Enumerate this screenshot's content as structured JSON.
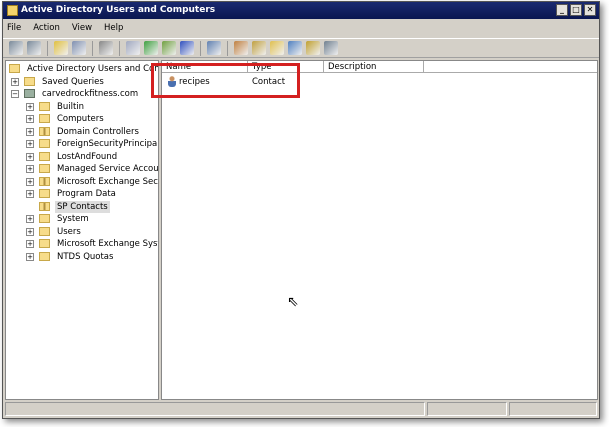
{
  "window": {
    "title": "Active Directory Users and Computers",
    "buttons": [
      "_",
      "□",
      "✕"
    ]
  },
  "menu": [
    "File",
    "Action",
    "View",
    "Help"
  ],
  "toolbar": [
    "back-icon",
    "forward-icon",
    "up-icon",
    "show-hide-tree-icon",
    "copy-icon",
    "properties-icon",
    "refresh-icon",
    "export-icon",
    "help-icon",
    "console-icon",
    "new-user-icon",
    "new-group-icon",
    "new-ou-icon",
    "filter-icon",
    "find-icon",
    "add-to-group-icon"
  ],
  "tree": [
    {
      "label": "Active Directory Users and Comput",
      "level": 0,
      "expander": "",
      "icon": "root"
    },
    {
      "label": "Saved Queries",
      "level": 1,
      "expander": "+",
      "icon": "folder"
    },
    {
      "label": "carvedrockfitness.com",
      "level": 1,
      "expander": "−",
      "icon": "domain"
    },
    {
      "label": "Builtin",
      "level": 2,
      "expander": "+",
      "icon": "folder"
    },
    {
      "label": "Computers",
      "level": 2,
      "expander": "+",
      "icon": "folder"
    },
    {
      "label": "Domain Controllers",
      "level": 2,
      "expander": "+",
      "icon": "ou"
    },
    {
      "label": "ForeignSecurityPrincipals",
      "level": 2,
      "expander": "+",
      "icon": "folder"
    },
    {
      "label": "LostAndFound",
      "level": 2,
      "expander": "+",
      "icon": "folder"
    },
    {
      "label": "Managed Service Accounts",
      "level": 2,
      "expander": "+",
      "icon": "folder"
    },
    {
      "label": "Microsoft Exchange Securit",
      "level": 2,
      "expander": "+",
      "icon": "ou"
    },
    {
      "label": "Program Data",
      "level": 2,
      "expander": "+",
      "icon": "folder"
    },
    {
      "label": "SP Contacts",
      "level": 2,
      "expander": "",
      "icon": "ou",
      "selected": true
    },
    {
      "label": "System",
      "level": 2,
      "expander": "+",
      "icon": "folder"
    },
    {
      "label": "Users",
      "level": 2,
      "expander": "+",
      "icon": "folder"
    },
    {
      "label": "Microsoft Exchange System",
      "level": 2,
      "expander": "+",
      "icon": "folder"
    },
    {
      "label": "NTDS Quotas",
      "level": 2,
      "expander": "+",
      "icon": "folder"
    }
  ],
  "list": {
    "columns": [
      "Name",
      "Type",
      "Description"
    ],
    "rows": [
      {
        "name": "recipes",
        "type": "Contact",
        "description": ""
      }
    ]
  },
  "highlight_color": "#d42020"
}
